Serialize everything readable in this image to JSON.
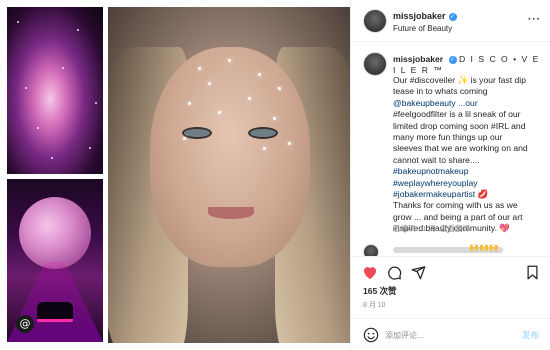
{
  "header": {
    "username": "missjobaker",
    "subtitle": "Future of Beauty",
    "more_icon": "more-horizontal-icon"
  },
  "caption": {
    "username": "missjobaker",
    "title": "D I S C O • V E I L E R ™",
    "lines": [
      "Our #discoveiler ✨ is your fast dip",
      "tease in to whats coming",
      "@bakeupbeauty ...our",
      "#feelgoodfilter is a lil sneak of our",
      "limited drop coming soon #IRL and",
      "many more fun things up our",
      "sleeves that we are working on and",
      "cannot wait to share....",
      "#bakeupnotmakeup",
      "#weplaywhereyouplay",
      "#jobakermakeupartist 💋",
      "Thanks for coming with us as we",
      "grow ... and being a part of our art",
      "inspired beauty community. 💖"
    ],
    "meta": "已编辑 · 1 周",
    "action": "查看翻译"
  },
  "actions": {
    "like_icon": "heart-filled-icon",
    "comment_icon": "comment-icon",
    "share_icon": "share-icon",
    "save_icon": "bookmark-icon",
    "like_color": "#ed4956"
  },
  "likes": "165 次赞",
  "date": "8 月 10",
  "add_comment": {
    "placeholder": "添加评论...",
    "post_label": "发布",
    "post_color": "#b2dffc"
  },
  "brand": {
    "link_color": "#00376b",
    "verified_color": "#3897f0"
  }
}
